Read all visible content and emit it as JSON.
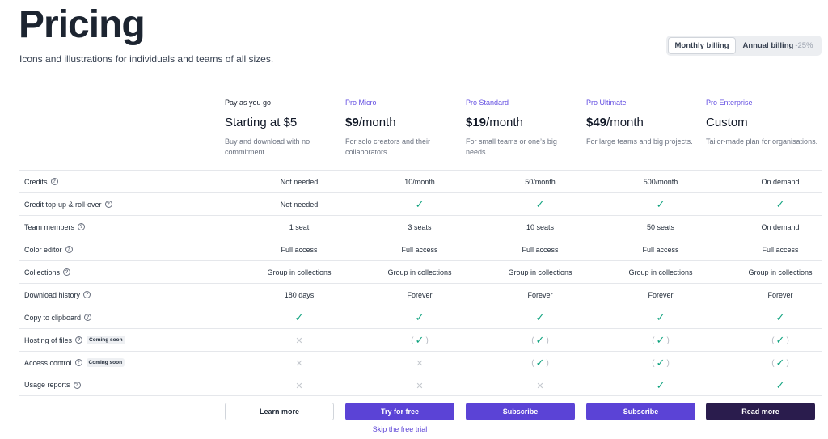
{
  "header": {
    "title": "Pricing",
    "subtitle": "Icons and illustrations for individuals and teams of all sizes."
  },
  "billing": {
    "monthly_label": "Monthly billing",
    "annual_label": "Annual billing",
    "annual_discount": "-25%",
    "selected": "monthly"
  },
  "plans": [
    {
      "name": "Pay as you go",
      "price_prefix": "",
      "price_main": "Starting at $5",
      "price_suffix": "",
      "desc": "Buy and download with no commitment."
    },
    {
      "name": "Pro Micro",
      "price_main": "$9",
      "price_suffix": "/month",
      "desc": "For solo creators and their collaborators."
    },
    {
      "name": "Pro Standard",
      "price_main": "$19",
      "price_suffix": "/month",
      "desc": "For small teams or one’s big needs."
    },
    {
      "name": "Pro Ultimate",
      "price_main": "$49",
      "price_suffix": "/month",
      "desc": "For large teams and big projects."
    },
    {
      "name": "Pro Enterprise",
      "price_main": "Custom",
      "price_suffix": "",
      "desc": "Tailor-made plan for organisations."
    }
  ],
  "features": [
    {
      "label": "Credits",
      "badge": "",
      "values": [
        "Not needed",
        "10/month",
        "50/month",
        "500/month",
        "On demand"
      ]
    },
    {
      "label": "Credit top-up & roll-over",
      "badge": "",
      "values": [
        "Not needed",
        "check",
        "check",
        "check",
        "check"
      ]
    },
    {
      "label": "Team members",
      "badge": "",
      "values": [
        "1 seat",
        "3 seats",
        "10 seats",
        "50 seats",
        "On demand"
      ]
    },
    {
      "label": "Color editor",
      "badge": "",
      "values": [
        "Full access",
        "Full access",
        "Full access",
        "Full access",
        "Full access"
      ]
    },
    {
      "label": "Collections",
      "badge": "",
      "values": [
        "Group in collections",
        "Group in collections",
        "Group in collections",
        "Group in collections",
        "Group in collections"
      ]
    },
    {
      "label": "Download history",
      "badge": "",
      "values": [
        "180 days",
        "Forever",
        "Forever",
        "Forever",
        "Forever"
      ]
    },
    {
      "label": "Copy to clipboard",
      "badge": "",
      "values": [
        "check",
        "check",
        "check",
        "check",
        "check"
      ]
    },
    {
      "label": "Hosting of files",
      "badge": "Coming soon",
      "values": [
        "cross",
        "soon-check",
        "soon-check",
        "soon-check",
        "soon-check"
      ]
    },
    {
      "label": "Access control",
      "badge": "Coming soon",
      "values": [
        "cross",
        "cross",
        "soon-check",
        "soon-check",
        "soon-check"
      ]
    },
    {
      "label": "Usage reports",
      "badge": "",
      "values": [
        "cross",
        "cross",
        "cross",
        "check",
        "check"
      ]
    }
  ],
  "buttons": [
    {
      "label": "Learn more",
      "style": "outline"
    },
    {
      "label": "Try for free",
      "style": "primary"
    },
    {
      "label": "Subscribe",
      "style": "primary"
    },
    {
      "label": "Subscribe",
      "style": "primary"
    },
    {
      "label": "Read more",
      "style": "dark"
    }
  ],
  "skip_trial_label": "Skip the free trial",
  "icons": {
    "check": "check-icon",
    "cross": "cross-icon",
    "info": "question-circle-icon"
  },
  "colors": {
    "accent": "#5b43d6",
    "check": "#10a37f",
    "enterprise_button": "#2a1c4d"
  }
}
